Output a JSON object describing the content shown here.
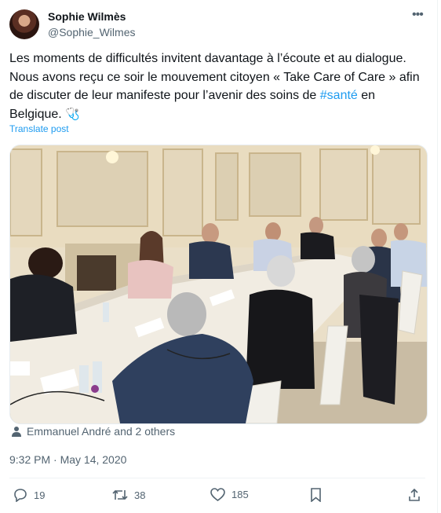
{
  "author": {
    "name": "Sophie Wilmès",
    "handle": "@Sophie_Wilmes"
  },
  "tweet": {
    "text_before": "Les moments de difficultés invitent davantage à l’écoute et au dialogue. Nous avons reçu ce soir le mouvement citoyen « Take Care of Care » afin de discuter de leur manifeste pour l’avenir des soins de ",
    "hashtag": "#santé",
    "text_after": " en Belgique. ",
    "emoji": "🩺"
  },
  "translate_label": "Translate post",
  "tagged_text": "Emmanuel André and 2 others",
  "timestamp": "9:32 PM · May 14, 2020",
  "actions": {
    "replies": "19",
    "reposts": "38",
    "likes": "185"
  },
  "icons": [
    "more-icon",
    "person-icon",
    "reply-icon",
    "repost-icon",
    "like-icon",
    "bookmark-icon",
    "share-icon",
    "stethoscope-icon"
  ],
  "colors": {
    "accent": "#1d9bf0",
    "muted": "#536471",
    "text": "#0f1419"
  }
}
